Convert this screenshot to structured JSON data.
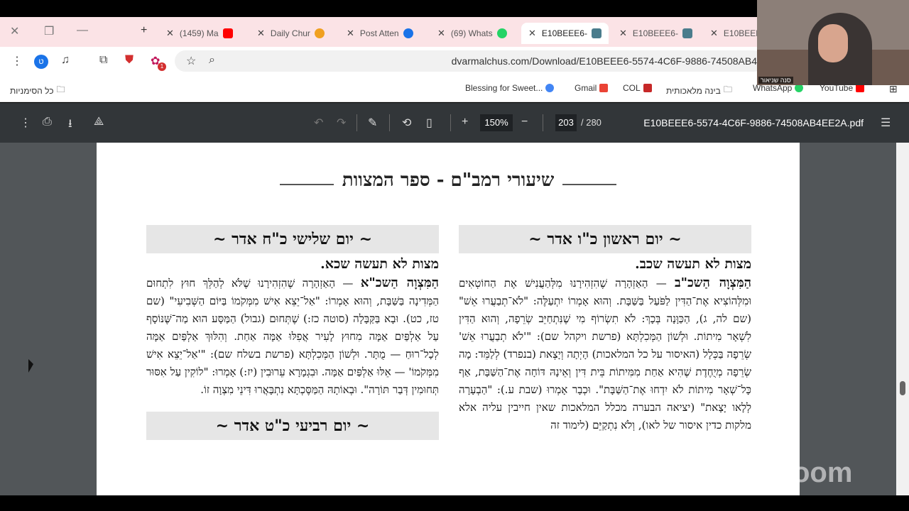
{
  "tabs": [
    {
      "label": "(1459) Ma",
      "favicon_color": "#ff0000"
    },
    {
      "label": "Daily Chur",
      "favicon_color": "#f0a020"
    },
    {
      "label": "Post Atten",
      "favicon_color": "#1a73e8"
    },
    {
      "label": "(69) Whats",
      "favicon_color": "#25d366"
    },
    {
      "label": "E10BEEE6-",
      "favicon_color": "#4a7c8c"
    },
    {
      "label": "E10BEEE6-",
      "favicon_color": "#4a7c8c"
    },
    {
      "label": "E10BEEE",
      "favicon_color": "#4a7c8c"
    }
  ],
  "toolbar": {
    "profile_letter": "ט",
    "notification_badge": "1",
    "url": "dvarmalchus.com/Download/E10BEEE6-5574-4C6F-9886-74508AB4"
  },
  "bookmarks": {
    "all_bookmarks": "כל הסימניות",
    "items": [
      "Blessing for Sweet...",
      "Gmail",
      "COL",
      "בינה מלאכותית",
      "WhatsApp",
      "YouTube"
    ]
  },
  "pdf": {
    "zoom": "150%",
    "page": "203",
    "total": "/ 280",
    "filename": "E10BEEE6-5574-4C6F-9886-74508AB4EE2A.pdf"
  },
  "page": {
    "title": "שיעורי רמב\"ם - ספר המצוות",
    "right": {
      "day": "~ יום ראשון כ\"ו אדר ~",
      "sub": "מצות לא תעשה שכב.",
      "lead": "הַמִּצְוָה הַשכ\"ב",
      "text": "— הָאַזְהָרָה שֶׁהִזְהִירָנוּ מִלְּהַעֲנִישׁ אֶת הַחוֹטְאִים וּמִלְּהוֹצִיא אֶת־הַדִּין לַפֹּעַל בַּשַּׁבָּת. וְהוּא אָמְרוֹ יִתְעַלֶּה: \"לֹא־תְבַעֲרוּ אֵשׁ\" (שם לה, ג), הַכַּוָּנָה בְּכָךְ: לֹא תִשְׂרוֹף מִי שֶׁנִּתְחַיֵּב שְׂרֵפָה, וְהוּא הַדִּין לִשְׁאָר מִיתוֹת. וּלְשׁוֹן הַמְּכִלְתָּא (פרשת ויקהל שם): \"'לֹא תְבַעֲרוּ אֵשׁ' שְׂרֵפָה בַּכְּלָל (האיסור על כל המלאכות) הָיְתָה וְיָצְאת (בנפרד) לְלַמֵּד: מָה שְׂרֵפָה מְיֻחֶדֶת שֶׁהִיא אַחַת מִמִּיתוֹת בֵּית דִּין וְאֵינָהּ דּוֹחָה אֶת־הַשַּׁבָּת, אַף כָּל־שְׁאָר מִיתוֹת לֹא יִדְחוּ אֶת־הַשַּׁבָּת\". וּכְבָר אָמְרוּ (שבת ע.): \"הַבְעָרָה לְלָאו יָצָאת\" (יציאה הבערה מכלל המלאכות שאין חייבין עליה אלא מלקות כדין איסור של לאו), וְלֹא נִתְקַיֵּם (לימוד זה"
    },
    "left": {
      "day": "~ יום שלישי כ\"ח אדר ~",
      "sub": "מצות לא תעשה שכא.",
      "lead": "הַמִּצְוָה הַשכ\"א",
      "text": "— הָאַזְהָרָה שֶׁהִזְהִירָנוּ שֶׁלֹּא לְהַלֵּךְ חוּץ לִתְחוּם הַמְּדִינָה בַּשַּׁבָּת, וְהוּא אָמְרוֹ: \"אַל־יֵצֵא אִישׁ מִמְּקֹמוֹ בַּיּוֹם הַשְּׁבִיעִי\" (שם טז, כט). וּבָא בַּקַּבָּלָה (סוטה כז:) שֶׁתְּחוּם (גבול) הַמַּסָּע הוּא מַה־שֶּׁנּוֹסָף עַל אַלְפַּיִם אַמָּה מִחוּץ לָעִיר אֲפִלּוּ אַמָּה אַחַת. וְהִלּוּךְ אַלְפַּיִם אַמָּה לְכָל־רוּחַ — מֻתָּר. וּלְשׁוֹן הַמְּכִלְתָּא (פרשת בשלח שם): \"'אַל־יֵצֵא אִישׁ מִמְּקֹמוֹ' — אֵלּוּ אַלְפַּיִם אַמָּה. וּבִגְמָרָא עֵרוּבִין (יז:) אָמְרוּ: \"לוֹקִין עַל אִסּוּר תְּחוּמִין דְּבַר תּוֹרָה\". וּבְאוֹתָהּ הַמַּסֶּכְתָּא נִתְבָּאֲרוּ דִּינֵי מִצְוָה זוֹ.",
      "day2": "~ יום רביעי כ\"ט אדר ~"
    }
  },
  "camera": {
    "name": "סנה שניאור"
  },
  "zoom_logo": "zoom"
}
